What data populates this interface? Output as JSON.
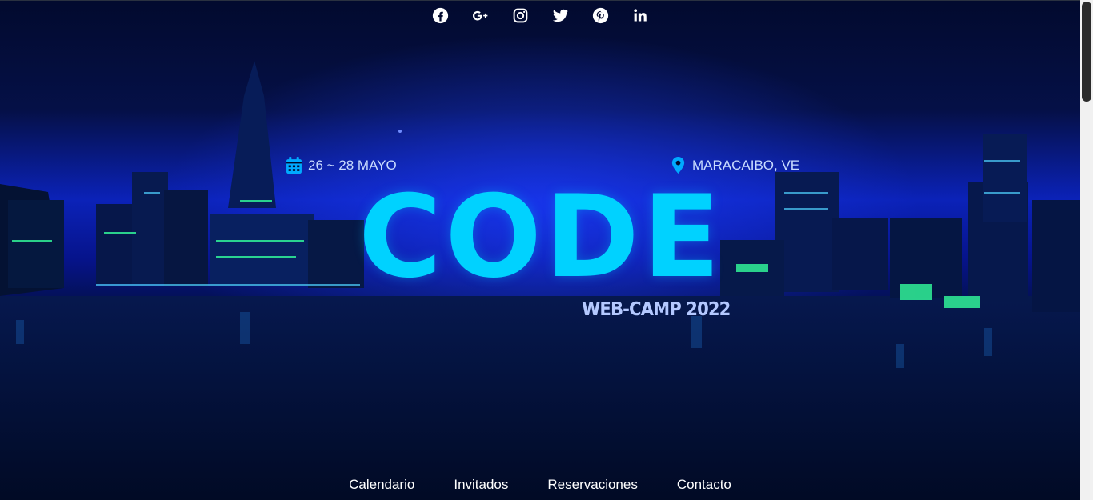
{
  "social": {
    "icons": [
      "facebook-icon",
      "google-plus-icon",
      "instagram-icon",
      "twitter-icon",
      "pinterest-icon",
      "linkedin-icon"
    ]
  },
  "event": {
    "date": "26 ~ 28 MAYO",
    "location": "MARACAIBO, VE",
    "title": "CODE",
    "subtitle": "WEB-CAMP 2022"
  },
  "nav": {
    "items": [
      "Calendario",
      "Invitados",
      "Reservaciones",
      "Contacto"
    ]
  },
  "colors": {
    "title": "#00d2ff",
    "subtitle": "#b4c8ff",
    "info_text": "#c9dcff",
    "nav_text": "#ffffff",
    "background": "#020a2e"
  }
}
